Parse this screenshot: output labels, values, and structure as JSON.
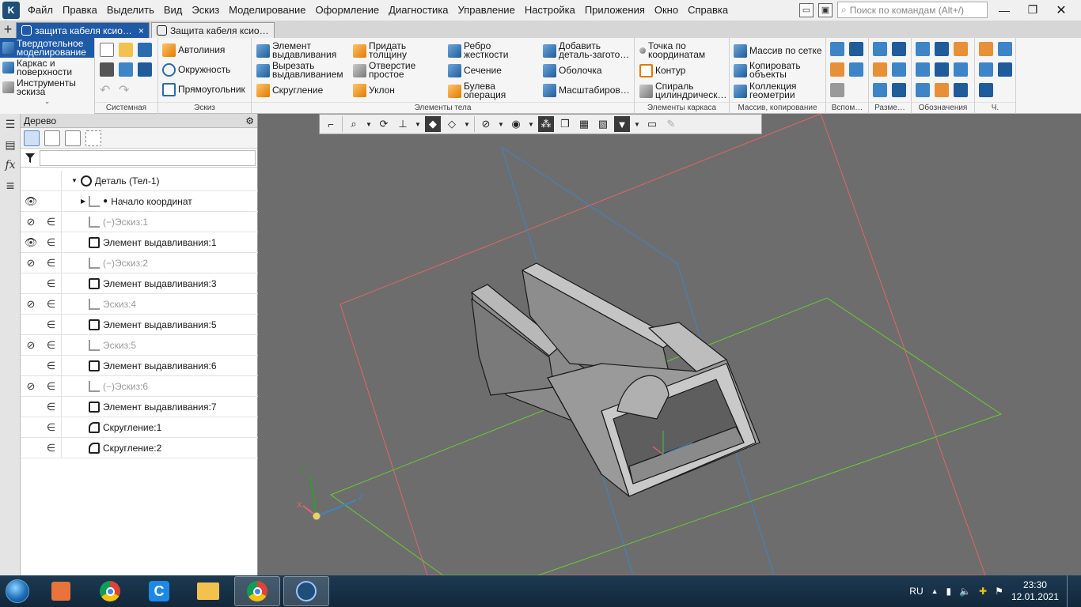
{
  "menu": {
    "items": [
      "Файл",
      "Правка",
      "Выделить",
      "Вид",
      "Эскиз",
      "Моделирование",
      "Оформление",
      "Диагностика",
      "Управление",
      "Настройка",
      "Приложения",
      "Окно",
      "Справка"
    ],
    "search_placeholder": "Поиск по командам (Alt+/)"
  },
  "tabs": [
    {
      "label": "защита кабеля ксио…",
      "close": "×"
    },
    {
      "label": "Защита кабеля ксио…"
    }
  ],
  "modes": [
    {
      "label1": "Твердотельное",
      "label2": "моделирование"
    },
    {
      "label1": "Каркас и",
      "label2": "поверхности"
    },
    {
      "label1": "Инструменты",
      "label2": "эскиза"
    }
  ],
  "ribbon": {
    "groups": {
      "system": "Системная",
      "sketch": "Эскиз",
      "solids": "Элементы тела",
      "frame": "Элементы каркаса",
      "array": "Массив, копирование",
      "aux": "Вспом…",
      "dims": "Разме…",
      "notations": "Обозначения",
      "last": "Ч."
    },
    "sketch": {
      "autoline": "Автолиния",
      "circle": "Окружность",
      "rect": "Прямоугольник"
    },
    "solids": {
      "extrude1": "Элемент",
      "extrude2": "выдавливания",
      "cut1": "Вырезать",
      "cut2": "выдавливанием",
      "fillet": "Скругление",
      "thick1": "Придать",
      "thick2": "толщину",
      "hole1": "Отверстие",
      "hole2": "простое",
      "draft": "Уклон",
      "rib1": "Ребро",
      "rib2": "жесткости",
      "section": "Сечение",
      "bool1": "Булева",
      "bool2": "операция",
      "addpart1": "Добавить",
      "addpart2": "деталь-загото…",
      "shell": "Оболочка",
      "scale": "Масштабиров…"
    },
    "frame": {
      "point1": "Точка по",
      "point2": "координатам",
      "contour": "Контур",
      "spiral1": "Спираль",
      "spiral2": "цилиндрическ…"
    },
    "array": {
      "grid": "Массив по сетке",
      "copy1": "Копировать",
      "copy2": "объекты",
      "coll1": "Коллекция",
      "coll2": "геометрии"
    }
  },
  "tree": {
    "title": "Дерево",
    "search_value": "",
    "root": "Деталь (Тел-1)",
    "origin": "Начало координат",
    "rows": [
      {
        "label": "(−)Эскиз:1",
        "eye": "hidden",
        "dim": true,
        "type": "sketch"
      },
      {
        "label": "Элемент выдавливания:1",
        "eye": "visible",
        "dim": false,
        "type": "extrude"
      },
      {
        "label": "(−)Эскиз:2",
        "eye": "hidden",
        "dim": true,
        "type": "sketch"
      },
      {
        "label": "Элемент выдавливания:3",
        "eye": "",
        "dim": false,
        "type": "extrude"
      },
      {
        "label": "Эскиз:4",
        "eye": "hidden",
        "dim": true,
        "type": "sketch"
      },
      {
        "label": "Элемент выдавливания:5",
        "eye": "",
        "dim": false,
        "type": "extrude"
      },
      {
        "label": "Эскиз:5",
        "eye": "hidden",
        "dim": true,
        "type": "sketch"
      },
      {
        "label": "Элемент выдавливания:6",
        "eye": "",
        "dim": false,
        "type": "extrude"
      },
      {
        "label": "(−)Эскиз:6",
        "eye": "hidden",
        "dim": true,
        "type": "sketch"
      },
      {
        "label": "Элемент выдавливания:7",
        "eye": "",
        "dim": false,
        "type": "extrude"
      },
      {
        "label": "Скругление:1",
        "eye": "",
        "dim": false,
        "type": "fillet"
      },
      {
        "label": "Скругление:2",
        "eye": "",
        "dim": false,
        "type": "fillet"
      }
    ]
  },
  "viewport": {
    "axes": {
      "x": "X",
      "y": "Y",
      "z": "Z"
    },
    "plane_colors": {
      "xy": "#e06666",
      "yz": "#3d85c6",
      "zx": "#66cc33"
    }
  },
  "taskbar": {
    "lang": "RU",
    "time": "23:30",
    "date": "12.01.2021"
  }
}
